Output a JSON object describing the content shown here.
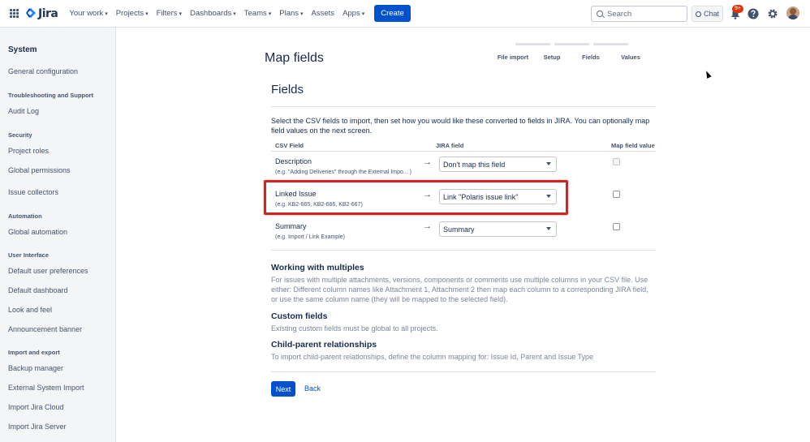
{
  "topnav": {
    "logo_text": "Jira",
    "items": [
      {
        "label": "Your work"
      },
      {
        "label": "Projects"
      },
      {
        "label": "Filters"
      },
      {
        "label": "Dashboards"
      },
      {
        "label": "Teams"
      },
      {
        "label": "Plans"
      },
      {
        "label": "Assets"
      },
      {
        "label": "Apps"
      }
    ],
    "create_label": "Create",
    "search_placeholder": "Search",
    "chat_label": "Chat",
    "notification_badge": "9+"
  },
  "sidebar": {
    "title": "System",
    "groups": [
      {
        "heading": "",
        "items": [
          "General configuration"
        ]
      },
      {
        "heading": "Troubleshooting and Support",
        "items": [
          "Audit Log"
        ]
      },
      {
        "heading": "Security",
        "items": [
          "Project roles",
          "Global permissions",
          "Issue collectors"
        ]
      },
      {
        "heading": "Automation",
        "items": [
          "Global automation"
        ]
      },
      {
        "heading": "User Interface",
        "items": [
          "Default user preferences",
          "Default dashboard",
          "Look and feel",
          "Announcement banner"
        ]
      },
      {
        "heading": "Import and export",
        "items": [
          "Backup manager",
          "External System Import",
          "Import Jira Cloud",
          "Import Jira Server"
        ]
      }
    ]
  },
  "main": {
    "title": "Map fields",
    "steps": [
      "File import",
      "Setup",
      "Fields",
      "Values"
    ],
    "section_title": "Fields",
    "intro": "Select the CSV fields to import, then set how you would like these converted to fields in JIRA. You can optionally map field values on the next screen.",
    "columns": {
      "csv": "CSV Field",
      "jira": "JIRA field",
      "map": "Map field value"
    },
    "rows": [
      {
        "name": "Description",
        "example": "(e.g.  \"Adding Deliveries\" through the External Impo... )",
        "jira": "Don't map this field"
      },
      {
        "name": "Linked Issue",
        "example": "(e.g.  KB2-665, KB2-666, KB2-667)",
        "jira": "Link \"Polaris issue link\""
      },
      {
        "name": "Summary",
        "example": "(e.g.  Import / Link Example)",
        "jira": "Summary"
      }
    ],
    "info": [
      {
        "title": "Working with multiples",
        "text": "For issues with multiple attachments, versions, components or comments use multiple columns in your CSV file. Use either: Different column names like Attachment 1, Attachment 2 then map each column to a corresponding JIRA field, or use the same column name (they will be mapped to the selected field)."
      },
      {
        "title": "Custom fields",
        "text": "Existing custom fields must be global to all projects."
      },
      {
        "title": "Child-parent relationships",
        "text": "To import child-parent relationships, define the column mapping for: Issue Id, Parent and Issue Type"
      }
    ],
    "next_label": "Next",
    "back_label": "Back"
  },
  "colors": {
    "primary": "#0052cc",
    "highlight": "#d3251f",
    "sidebar_bg": "#f4f5f7"
  }
}
